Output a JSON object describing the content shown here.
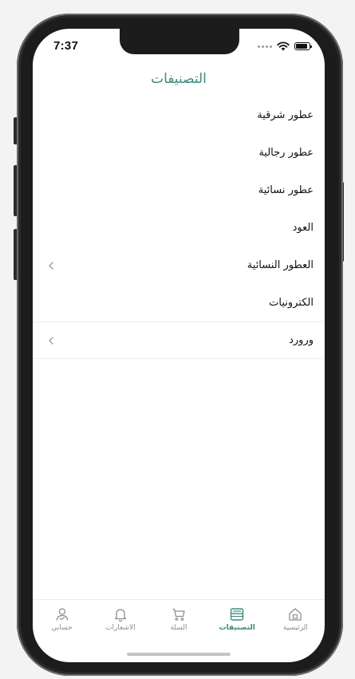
{
  "status_bar": {
    "time": "7:37"
  },
  "header": {
    "title": "التصنيفات"
  },
  "categories": [
    {
      "label": "عطور شرقية",
      "has_chevron": false
    },
    {
      "label": "عطور رجالية",
      "has_chevron": false
    },
    {
      "label": "عطور نسائية",
      "has_chevron": false
    },
    {
      "label": "العود",
      "has_chevron": false
    },
    {
      "label": "العطور النسائية",
      "has_chevron": true
    },
    {
      "label": "الكترونيات",
      "has_chevron": false
    },
    {
      "label": "ورورد",
      "has_chevron": true
    }
  ],
  "tab_bar": {
    "tabs": [
      {
        "label": "حسابي",
        "icon": "user-icon",
        "active": false
      },
      {
        "label": "الاشعارات",
        "icon": "bell-icon",
        "active": false
      },
      {
        "label": "السلة",
        "icon": "cart-icon",
        "active": false
      },
      {
        "label": "التصنيفات",
        "icon": "categories-icon",
        "active": true
      },
      {
        "label": "الرئيسية",
        "icon": "home-icon",
        "active": false
      }
    ]
  },
  "colors": {
    "accent": "#3d8c7e",
    "inactive": "#8e8e8e",
    "text": "#111111"
  }
}
